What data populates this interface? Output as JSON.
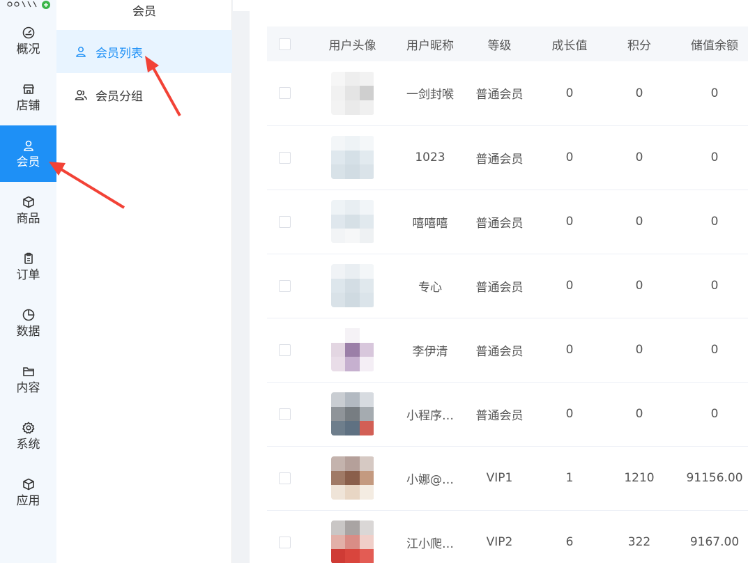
{
  "rail": {
    "items": [
      {
        "label": "概况",
        "icon": "dashboard-icon"
      },
      {
        "label": "店铺",
        "icon": "store-icon"
      },
      {
        "label": "会员",
        "icon": "user-icon",
        "active": true
      },
      {
        "label": "商品",
        "icon": "box-icon"
      },
      {
        "label": "订单",
        "icon": "clipboard-icon"
      },
      {
        "label": "数据",
        "icon": "pie-chart-icon"
      },
      {
        "label": "内容",
        "icon": "folder-icon"
      },
      {
        "label": "系统",
        "icon": "gear-icon"
      },
      {
        "label": "应用",
        "icon": "cube-icon"
      }
    ]
  },
  "submenu": {
    "title": "会员",
    "items": [
      {
        "label": "会员列表",
        "icon": "user-icon",
        "active": true
      },
      {
        "label": "会员分组",
        "icon": "users-icon"
      }
    ]
  },
  "table": {
    "headers": [
      "",
      "用户头像",
      "用户昵称",
      "等级",
      "成长值",
      "积分",
      "储值余额"
    ],
    "rows": [
      {
        "nickname": "一剑封喉",
        "level": "普通会员",
        "growth": "0",
        "points": "0",
        "balance": "0",
        "avatar_colors": [
          "#f6f6f6",
          "#eeeeee",
          "#f2f2f2",
          "#f1f1f1",
          "#e4e4e4",
          "#cfcfcf",
          "#f3f3f3",
          "#eaeaea",
          "#f0f0f0"
        ]
      },
      {
        "nickname": "1023",
        "level": "普通会员",
        "growth": "0",
        "points": "0",
        "balance": "0",
        "avatar_colors": [
          "#f3f6f8",
          "#eef3f6",
          "#f4f7f9",
          "#dfe8ee",
          "#d5e0e7",
          "#e2eaef",
          "#d8e2e8",
          "#d1dce3",
          "#dae3e9"
        ]
      },
      {
        "nickname": "嘻嘻嘻",
        "level": "普通会员",
        "growth": "0",
        "points": "0",
        "balance": "0",
        "avatar_colors": [
          "#eef3f6",
          "#e8eef2",
          "#f1f5f8",
          "#dfe7ed",
          "#d6e0e6",
          "#e1e9ee",
          "#f2f4f6",
          "#f6f7f8",
          "#eef1f3"
        ]
      },
      {
        "nickname": "专心",
        "level": "普通会员",
        "growth": "0",
        "points": "0",
        "balance": "0",
        "avatar_colors": [
          "#f0f3f6",
          "#e9eef2",
          "#f3f6f8",
          "#dde6ec",
          "#d3dde4",
          "#e0e8ed",
          "#d9e2e8",
          "#cfdae1",
          "#dbe4ea"
        ]
      },
      {
        "nickname": "李伊清",
        "level": "普通会员",
        "growth": "0",
        "points": "0",
        "balance": "0",
        "avatar_colors": [
          "#ffffff",
          "#f5f2f6",
          "#ffffff",
          "#e3d6e2",
          "#9b7fa8",
          "#d8c7dc",
          "#e9dde8",
          "#c6b0cf",
          "#f4eef5"
        ]
      },
      {
        "nickname": "小程序…",
        "level": "普通会员",
        "growth": "0",
        "points": "0",
        "balance": "0",
        "avatar_colors": [
          "#c9cdd2",
          "#b3bac2",
          "#d7dbe0",
          "#8f9499",
          "#777d82",
          "#a5abb0",
          "#6e7e8c",
          "#5f7182",
          "#d25f55"
        ]
      },
      {
        "nickname": "小娜@…",
        "level": "VIP1",
        "growth": "1",
        "points": "1210",
        "balance": "91156.00",
        "avatar_colors": [
          "#c4b3ad",
          "#b5a09a",
          "#d6c9c3",
          "#a07a66",
          "#8a5f4b",
          "#c49a80",
          "#efe4d8",
          "#e8d6c4",
          "#f4ece2"
        ]
      },
      {
        "nickname": "江小爬…",
        "level": "VIP2",
        "growth": "6",
        "points": "322",
        "balance": "9167.00",
        "avatar_colors": [
          "#c9c6c5",
          "#a9a4a3",
          "#dad7d6",
          "#e2b0a8",
          "#d98d86",
          "#f0cfc9",
          "#cf3b35",
          "#d9453d",
          "#e35c54"
        ]
      }
    ]
  }
}
